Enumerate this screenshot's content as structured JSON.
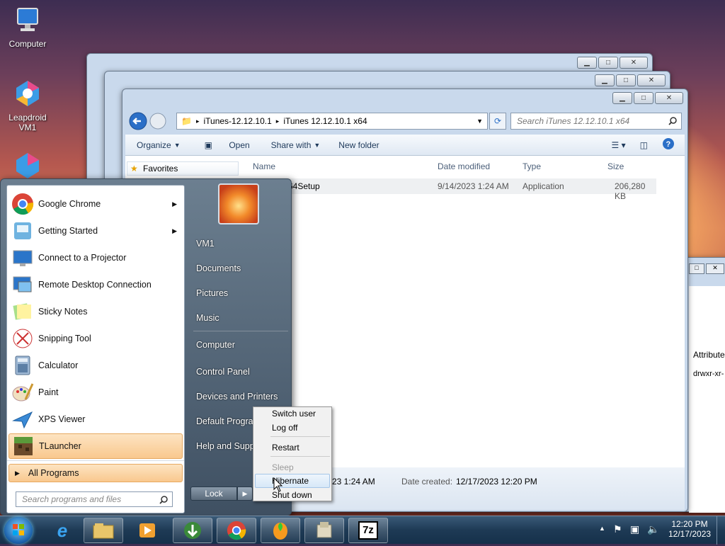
{
  "desktop": {
    "icons": [
      {
        "label": "Computer",
        "icon": "computer-icon"
      },
      {
        "label": "Leapdroid VM1",
        "icon": "leapdroid-icon"
      },
      {
        "label": "",
        "icon": "leapdroid-icon"
      }
    ]
  },
  "explorer": {
    "address_parts": [
      "iTunes-12.12.10.1",
      "iTunes 12.12.10.1 x64"
    ],
    "search_placeholder": "Search iTunes 12.12.10.1 x64",
    "toolbar": {
      "organize": "Organize",
      "open": "Open",
      "share_with": "Share with",
      "new_folder": "New folder"
    },
    "nav": {
      "favorites": "Favorites"
    },
    "columns": {
      "name": "Name",
      "date_modified": "Date modified",
      "type": "Type",
      "size": "Size"
    },
    "file": {
      "name": "x64Setup",
      "date_modified": "9/14/2023 1:24 AM",
      "type": "Application",
      "size": "206,280 KB"
    },
    "details": {
      "date_modified_partial": "23 1:24 AM",
      "date_created_label": "Date created:",
      "date_created": "12/17/2023 12:20 PM"
    }
  },
  "background_window": {
    "attribute_header": "Attribute",
    "attribute_value": "drwxr-xr-"
  },
  "start_menu": {
    "pinned": [
      {
        "label": "Google Chrome",
        "icon": "chrome-icon",
        "submenu": true
      },
      {
        "label": "Getting Started",
        "icon": "getting-started-icon",
        "submenu": true
      },
      {
        "label": "Connect to a Projector",
        "icon": "projector-icon",
        "submenu": false
      },
      {
        "label": "Remote Desktop Connection",
        "icon": "remote-desktop-icon",
        "submenu": false
      },
      {
        "label": "Sticky Notes",
        "icon": "sticky-notes-icon",
        "submenu": false
      },
      {
        "label": "Snipping Tool",
        "icon": "snipping-tool-icon",
        "submenu": false
      },
      {
        "label": "Calculator",
        "icon": "calculator-icon",
        "submenu": false
      },
      {
        "label": "Paint",
        "icon": "paint-icon",
        "submenu": false
      },
      {
        "label": "XPS Viewer",
        "icon": "xps-viewer-icon",
        "submenu": false
      },
      {
        "label": "TLauncher",
        "icon": "tlauncher-icon",
        "submenu": false
      }
    ],
    "all_programs": "All Programs",
    "search_placeholder": "Search programs and files",
    "right_items": [
      "VM1",
      "Documents",
      "Pictures",
      "Music",
      "Computer",
      "Control Panel",
      "Devices and Printers",
      "Default Programs",
      "Help and Support"
    ],
    "lock_label": "Lock"
  },
  "power_menu": {
    "items": [
      {
        "label": "Switch user",
        "enabled": true
      },
      {
        "label": "Log off",
        "enabled": true
      },
      {
        "label": "Restart",
        "enabled": true
      },
      {
        "label": "Sleep",
        "enabled": false
      },
      {
        "label": "Hibernate",
        "enabled": true
      },
      {
        "label": "Shut down",
        "enabled": true
      }
    ]
  },
  "taskbar": {
    "apps": [
      "start-orb-icon",
      "internet-explorer-icon",
      "file-explorer-icon",
      "media-player-icon",
      "download-manager-icon",
      "chrome-icon",
      "fl-studio-icon",
      "installer-icon",
      "7zip-icon"
    ],
    "sevenzip_label": "7z",
    "clock": {
      "time": "12:20 PM",
      "date": "12/17/2023"
    }
  },
  "colors": {
    "accent": "#1e395b",
    "highlight": "#f9c88e",
    "taskbar": "#1e3a55"
  }
}
